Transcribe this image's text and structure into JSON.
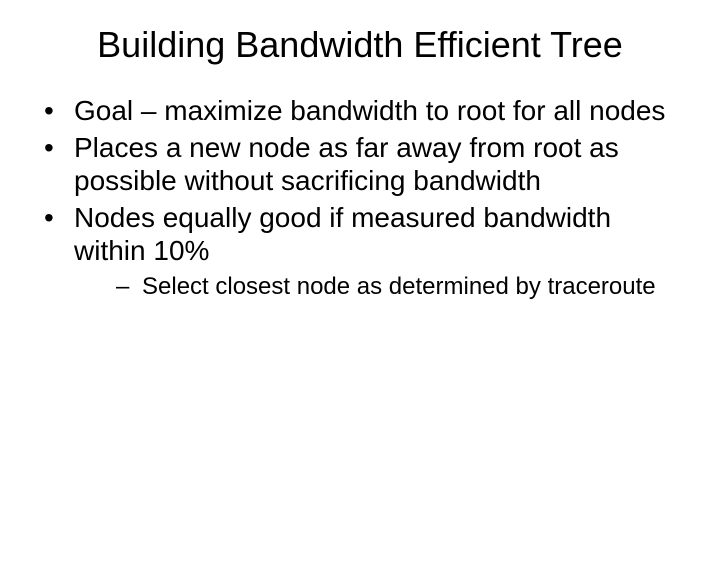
{
  "slide": {
    "title": "Building Bandwidth Efficient Tree",
    "bullets": [
      {
        "text": "Goal – maximize bandwidth to root for all nodes"
      },
      {
        "text": "Places a new node as far away from root as possible without sacrificing bandwidth"
      },
      {
        "text": "Nodes equally good if measured bandwidth within 10%",
        "sub": [
          {
            "text": "Select closest node as determined by traceroute"
          }
        ]
      }
    ]
  }
}
